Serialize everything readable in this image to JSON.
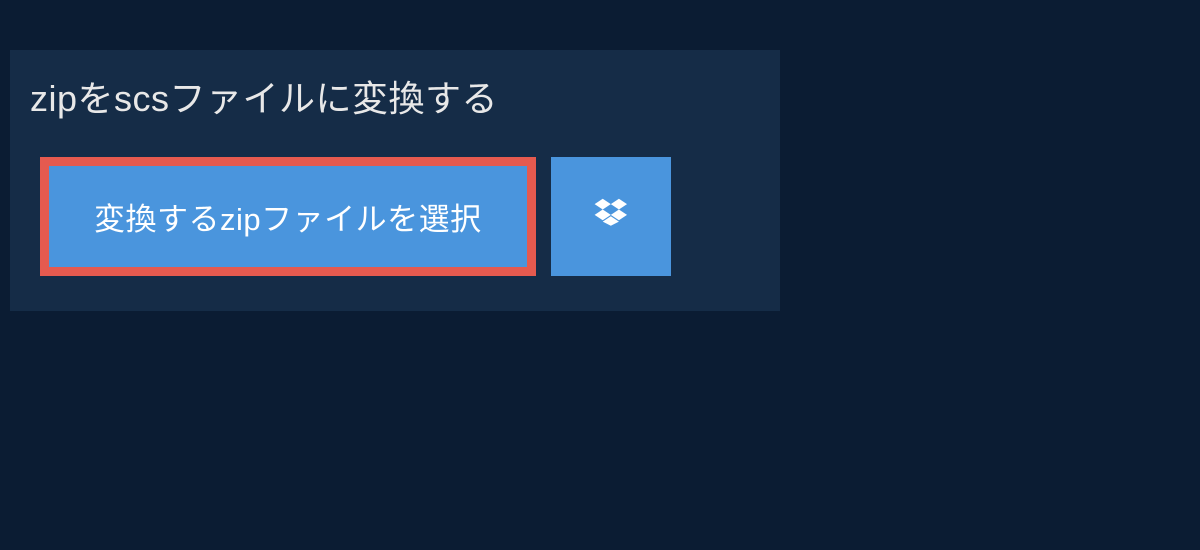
{
  "heading": "zipをscsファイルに変換する",
  "buttons": {
    "select_file_label": "変換するzipファイルを選択"
  }
}
